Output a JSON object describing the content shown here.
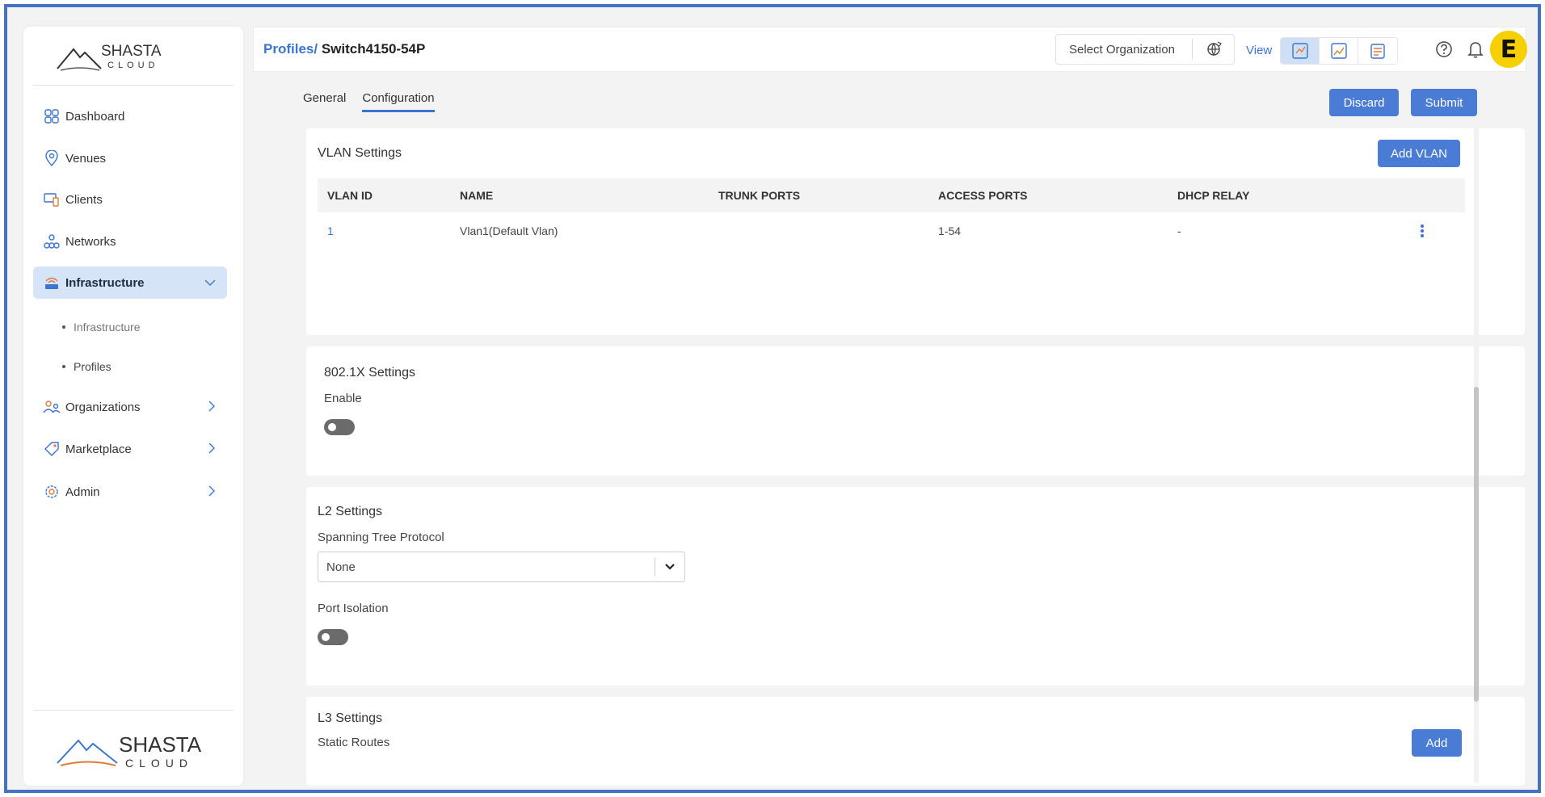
{
  "brand": {
    "name_top": "SHASTA",
    "name_bottom": "CLOUD",
    "accent": "#4a7bd5"
  },
  "sidebar": {
    "items": [
      {
        "label": "Dashboard",
        "icon": "dashboard-icon"
      },
      {
        "label": "Venues",
        "icon": "location-pin-icon"
      },
      {
        "label": "Clients",
        "icon": "clients-icon"
      },
      {
        "label": "Networks",
        "icon": "network-icon"
      },
      {
        "label": "Infrastructure",
        "icon": "infrastructure-icon",
        "active": true
      },
      {
        "label": "Organizations",
        "icon": "organizations-icon"
      },
      {
        "label": "Marketplace",
        "icon": "marketplace-icon"
      },
      {
        "label": "Admin",
        "icon": "admin-gear-icon"
      }
    ],
    "sub_items": [
      {
        "label": "Infrastructure"
      },
      {
        "label": "Profiles"
      }
    ]
  },
  "header": {
    "breadcrumb_link": "Profiles/",
    "breadcrumb_current": "Switch4150-54P",
    "org_select_placeholder": "Select Organization",
    "view_label": "View",
    "avatar_letter": "E"
  },
  "tabs": [
    {
      "label": "General"
    },
    {
      "label": "Configuration",
      "active": true
    }
  ],
  "actions": {
    "discard": "Discard",
    "submit": "Submit"
  },
  "vlan": {
    "title": "VLAN Settings",
    "add_button": "Add VLAN",
    "columns": [
      "VLAN ID",
      "NAME",
      "TRUNK PORTS",
      "ACCESS PORTS",
      "DHCP RELAY"
    ],
    "rows": [
      {
        "id": "1",
        "name": "Vlan1(Default Vlan)",
        "trunk": "",
        "access": "1-54",
        "dhcp": "-"
      }
    ]
  },
  "dot1x": {
    "title": "802.1X Settings",
    "enable_label": "Enable",
    "enabled": false
  },
  "l2": {
    "title": "L2 Settings",
    "stp_label": "Spanning Tree Protocol",
    "stp_value": "None",
    "port_isolation_label": "Port Isolation",
    "port_isolation_enabled": false
  },
  "l3": {
    "title": "L3 Settings",
    "static_routes_label": "Static Routes",
    "add_button": "Add"
  }
}
